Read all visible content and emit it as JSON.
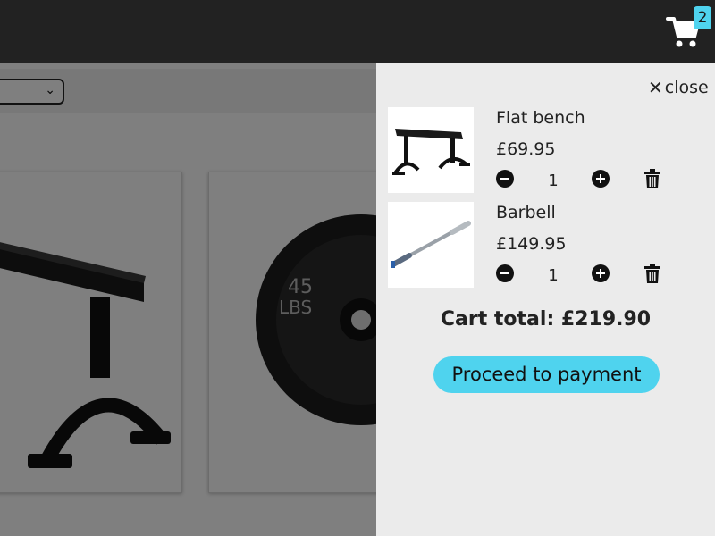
{
  "header": {
    "cart_count": "2",
    "cart_icon": "cart-icon"
  },
  "cart": {
    "close_label": "close",
    "close_icon": "close-icon",
    "items": [
      {
        "name": "Flat bench",
        "price": "£69.95",
        "quantity": "1"
      },
      {
        "name": "Barbell",
        "price": "£149.95",
        "quantity": "1"
      }
    ],
    "total_label": "Cart total: £219.90",
    "pay_label": "Proceed to payment"
  },
  "colors": {
    "topbar": "#222222",
    "accent": "#4fd3ee",
    "panel": "#ebebeb"
  }
}
